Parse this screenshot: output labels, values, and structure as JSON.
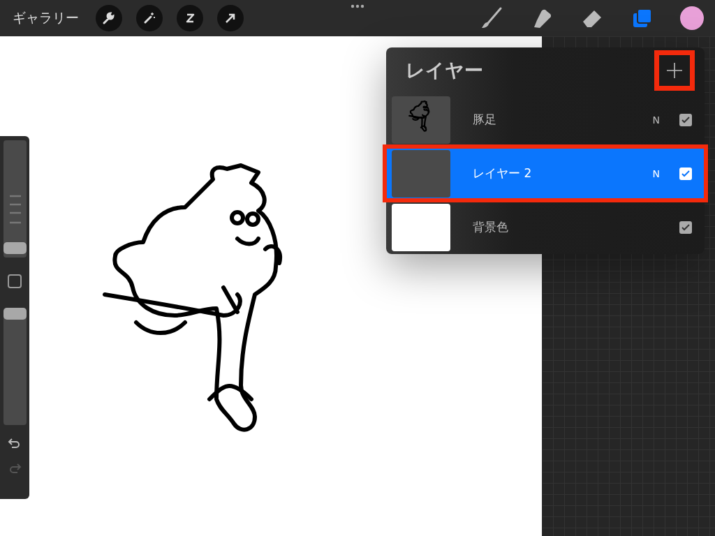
{
  "toolbar": {
    "gallery_label": "ギャラリー",
    "tools_left": [
      {
        "kind": "wrench"
      },
      {
        "kind": "magic"
      },
      {
        "kind": "selection"
      },
      {
        "kind": "transform"
      }
    ],
    "tools_right": [
      {
        "kind": "brush",
        "selected": false
      },
      {
        "kind": "smudge",
        "selected": false
      },
      {
        "kind": "eraser",
        "selected": false
      },
      {
        "kind": "layers",
        "selected": true
      }
    ],
    "color_swatch": {
      "color": "#e8a0d8"
    }
  },
  "sidebar": {
    "sliders": [
      {
        "kind": "size",
        "level": 0.03
      },
      {
        "kind": "opacity",
        "level": 1
      }
    ]
  },
  "layers_panel": {
    "title": "レイヤー",
    "add_highlighted": true,
    "layers": [
      {
        "name": "豚足",
        "kind": "artwork",
        "blend": "N",
        "visible": true,
        "selected": false,
        "highlighted": false
      },
      {
        "name": "レイヤー 2",
        "kind": "empty",
        "blend": "N",
        "visible": true,
        "selected": true,
        "highlighted": true
      },
      {
        "name": "背景色",
        "kind": "background",
        "visible": true,
        "selected": false,
        "highlighted": false
      }
    ]
  }
}
